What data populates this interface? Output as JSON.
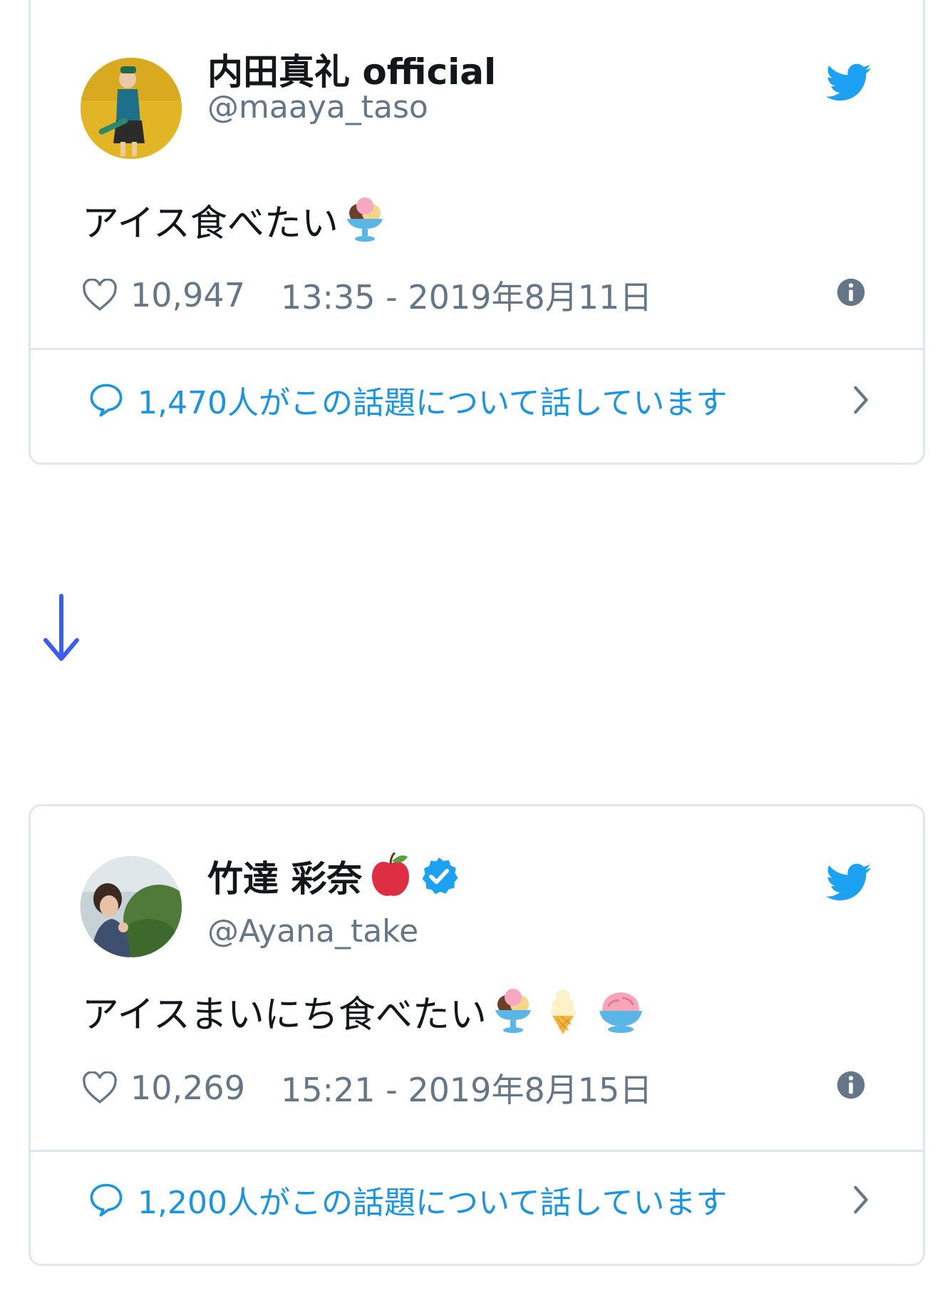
{
  "tweets": [
    {
      "display_name": "内田真礼 official",
      "handle": "@maaya_taso",
      "text": "アイス食べたい",
      "emoji": [
        "ice-cream-sundae"
      ],
      "likes": "10,947",
      "timestamp": "13:35 - 2019年8月11日",
      "conversation": "1,470人がこの話題について話しています",
      "verified": false
    },
    {
      "display_name": "竹達 彩奈",
      "name_emoji": "red-apple",
      "handle": "@Ayana_take",
      "text": "アイスまいにち食べたい",
      "emoji": [
        "ice-cream-sundae",
        "soft-ice-cream",
        "shaved-ice"
      ],
      "likes": "10,269",
      "timestamp": "15:21 - 2019年8月15日",
      "conversation": "1,200人がこの話題について話しています",
      "verified": true
    }
  ],
  "colors": {
    "twitter_blue": "#1da1f2",
    "link_blue": "#1b95e0",
    "arrow_blue": "#3a5ff0",
    "secondary_text": "#657786",
    "border": "#e1e8ed"
  }
}
